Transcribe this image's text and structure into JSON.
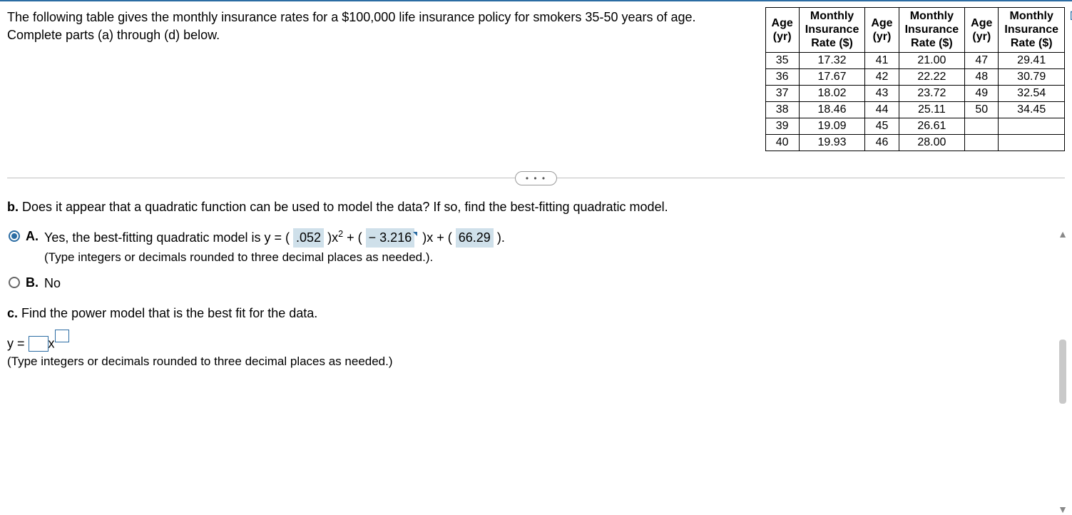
{
  "intro": {
    "line1": "The following table gives the monthly insurance rates for a $100,000 life insurance policy for smokers 35-50 years of age.",
    "line2": "Complete parts (a) through (d) below."
  },
  "table": {
    "headers": {
      "age": "Age (yr)",
      "rate": "Monthly Insurance Rate ($)"
    },
    "col1": [
      {
        "age": "35",
        "rate": "17.32"
      },
      {
        "age": "36",
        "rate": "17.67"
      },
      {
        "age": "37",
        "rate": "18.02"
      },
      {
        "age": "38",
        "rate": "18.46"
      },
      {
        "age": "39",
        "rate": "19.09"
      },
      {
        "age": "40",
        "rate": "19.93"
      }
    ],
    "col2": [
      {
        "age": "41",
        "rate": "21.00"
      },
      {
        "age": "42",
        "rate": "22.22"
      },
      {
        "age": "43",
        "rate": "23.72"
      },
      {
        "age": "44",
        "rate": "25.11"
      },
      {
        "age": "45",
        "rate": "26.61"
      },
      {
        "age": "46",
        "rate": "28.00"
      }
    ],
    "col3": [
      {
        "age": "47",
        "rate": "29.41"
      },
      {
        "age": "48",
        "rate": "30.79"
      },
      {
        "age": "49",
        "rate": "32.54"
      },
      {
        "age": "50",
        "rate": "34.45"
      },
      {
        "age": "",
        "rate": ""
      },
      {
        "age": "",
        "rate": ""
      }
    ]
  },
  "ellipsis": "• • •",
  "partB": {
    "prompt_label": "b.",
    "prompt": "Does it appear that a quadratic function can be used to model the data? If so, find the best-fitting quadratic model.",
    "choiceA": {
      "letter": "A.",
      "prefix": "Yes, the best-fitting quadratic model is y = (",
      "a": ".052",
      "mid1": ")x",
      "sq": "2",
      "mid2": " + (",
      "b": " − 3.216",
      "mid3": ")x + (",
      "c": "66.29",
      "suffix": ").",
      "hint": "(Type integers or decimals rounded to three decimal places as needed.)."
    },
    "choiceB": {
      "letter": "B.",
      "text": "No"
    }
  },
  "partC": {
    "prompt_label": "c.",
    "prompt": "Find the power model that is the best fit for the data.",
    "eq_prefix": "y =",
    "eq_x": "x",
    "hint": "(Type integers or decimals rounded to three decimal places as needed.)"
  }
}
